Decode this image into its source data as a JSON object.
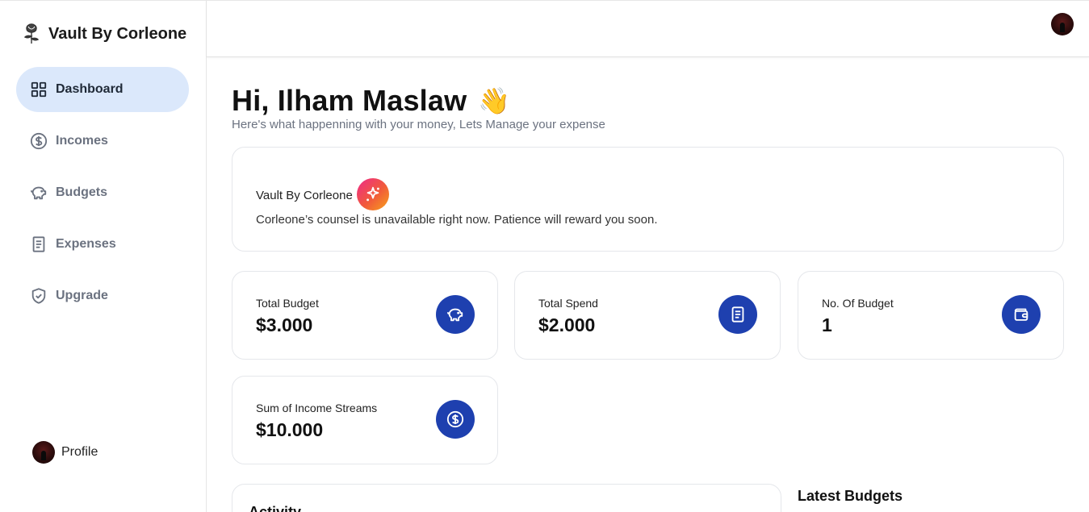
{
  "app": {
    "name": "Vault By Corleone"
  },
  "sidebar": {
    "items": [
      {
        "label": "Dashboard",
        "icon": "dashboard-grid-icon",
        "active": true
      },
      {
        "label": "Incomes",
        "icon": "dollar-circle-icon",
        "active": false
      },
      {
        "label": "Budgets",
        "icon": "piggy-bank-icon",
        "active": false
      },
      {
        "label": "Expenses",
        "icon": "receipt-icon",
        "active": false
      },
      {
        "label": "Upgrade",
        "icon": "shield-check-icon",
        "active": false
      }
    ],
    "profile_label": "Profile"
  },
  "main": {
    "greeting": "Hi, Ilham Maslaw",
    "wave_emoji": "👋",
    "subtitle": "Here's what happenning with your money, Lets Manage your expense",
    "ai_card": {
      "title": "Vault By Corleone",
      "message": "Corleone’s counsel is unavailable right now. Patience will reward you soon."
    },
    "stats": [
      {
        "label": "Total Budget",
        "value": "$3.000",
        "icon": "piggy-bank-icon"
      },
      {
        "label": "Total Spend",
        "value": "$2.000",
        "icon": "receipt-icon"
      },
      {
        "label": "No. Of Budget",
        "value": "1",
        "icon": "wallet-icon"
      },
      {
        "label": "Sum of Income Streams",
        "value": "$10.000",
        "icon": "dollar-circle-icon"
      }
    ],
    "activity_title": "Activity",
    "latest_budgets_title": "Latest Budgets"
  },
  "colors": {
    "accent": "#1e40af",
    "active_nav_bg": "#dbe8fb",
    "muted_text": "#6b7280"
  }
}
